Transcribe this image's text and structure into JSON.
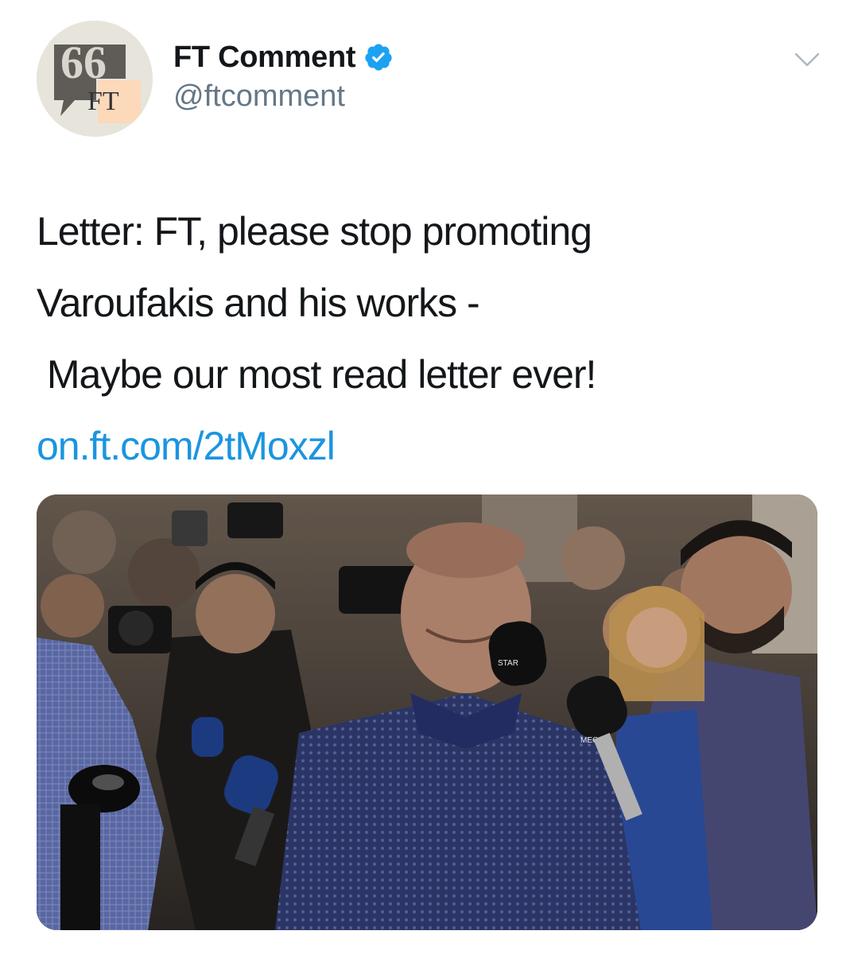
{
  "tweet": {
    "display_name": "FT Comment",
    "handle": "@ftcomment",
    "avatar_text": "FT",
    "verified_icon": "verified-badge-icon",
    "menu_icon": "chevron-down-icon",
    "text_lines": [
      "Letter: FT, please stop promoting",
      "Varoufakis and his works -",
      " Maybe our most read letter ever!"
    ],
    "link": "on.ft.com/2tMoxzl",
    "media": {
      "type": "photo",
      "microphone_labels": [
        "STAR",
        "MEGA"
      ]
    }
  },
  "colors": {
    "link": "#1b95e0",
    "verified": "#1da1f2",
    "handle": "#657786",
    "ft_pink": "#fcd9b8"
  }
}
